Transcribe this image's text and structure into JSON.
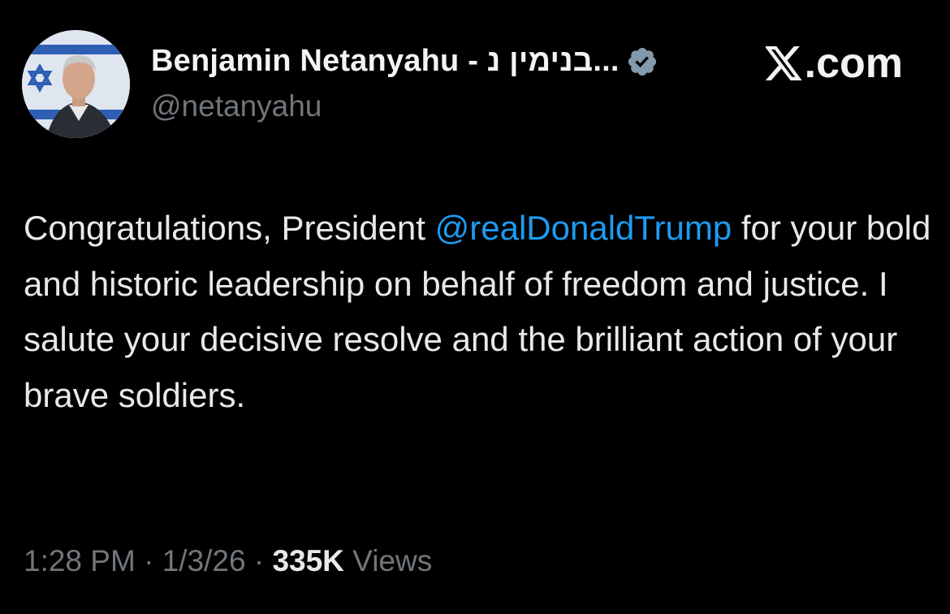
{
  "author": {
    "display_name": "Benjamin Netanyahu - בנימין נ...",
    "handle": "@netanyahu",
    "verified_icon": "verified-badge-icon",
    "avatar": "profile-photo"
  },
  "brand": {
    "label": ".com",
    "logo_icon": "x-logo-icon"
  },
  "tweet": {
    "text_before_mention": "Congratulations, President ",
    "mention": "@realDonaldTrump",
    "text_after_mention": " for your bold and historic leadership on behalf of freedom and justice. I salute your decisive resolve and the brilliant action of your brave soldiers."
  },
  "meta": {
    "time": "1:28 PM",
    "separator": " · ",
    "date": "1/3/26",
    "views_count": "335K",
    "views_label": " Views"
  },
  "colors": {
    "background": "#000000",
    "text": "#e7e9ea",
    "secondary": "#71767b",
    "link": "#1d9bf0",
    "verified": "#829aab"
  }
}
